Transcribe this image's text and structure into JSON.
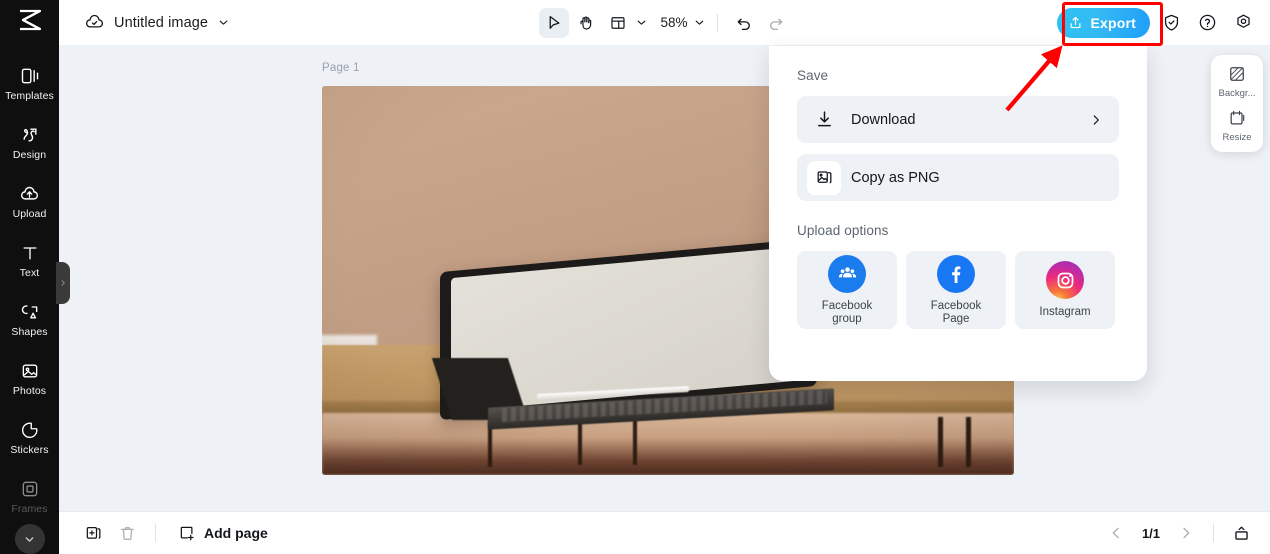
{
  "app": {
    "logo_icon": "capcut-logo-icon"
  },
  "sidebar": {
    "items": [
      {
        "label": "Templates",
        "icon": "templates-icon",
        "dim": false
      },
      {
        "label": "Design",
        "icon": "design-icon",
        "dim": false
      },
      {
        "label": "Upload",
        "icon": "upload-cloud-icon",
        "dim": false
      },
      {
        "label": "Text",
        "icon": "text-icon",
        "dim": false
      },
      {
        "label": "Shapes",
        "icon": "shapes-icon",
        "dim": false
      },
      {
        "label": "Photos",
        "icon": "photos-icon",
        "dim": false
      },
      {
        "label": "Stickers",
        "icon": "stickers-icon",
        "dim": false
      },
      {
        "label": "Frames",
        "icon": "frames-icon",
        "dim": true
      }
    ],
    "more_icon": "chevron-down-icon",
    "collapse_handle_icon": "chevron-right-icon"
  },
  "topbar": {
    "cloud_icon": "cloud-saved-icon",
    "doc_title": "Untitled image",
    "title_chevron_icon": "chevron-down-icon",
    "select_tool_icon": "cursor-arrow-icon",
    "hand_tool_icon": "hand-icon",
    "layout_tool_icon": "layout-grid-icon",
    "layout_chevron_icon": "chevron-down-icon",
    "zoom_value": "58%",
    "zoom_chevron_icon": "chevron-down-icon",
    "undo_icon": "undo-icon",
    "redo_icon": "redo-icon",
    "export_label": "Export",
    "export_icon": "upload-share-icon",
    "export_color": "#2ab5f2",
    "shield_icon": "shield-check-icon",
    "help_icon": "question-circle-icon",
    "settings_icon": "settings-gear-icon",
    "highlight_color": "#ff0000"
  },
  "canvas": {
    "page_label": "Page 1",
    "background_color": "#eef1f5"
  },
  "right_tools": {
    "items": [
      {
        "label": "Backgr...",
        "icon": "background-pattern-icon"
      },
      {
        "label": "Resize",
        "icon": "resize-icon"
      }
    ]
  },
  "export_panel": {
    "save_heading": "Save",
    "save_items": [
      {
        "label": "Download",
        "icon": "download-icon",
        "chevron": "chevron-right-icon",
        "has_white_box": false
      },
      {
        "label": "Copy as PNG",
        "icon": "copy-image-icon",
        "chevron": "",
        "has_white_box": true
      }
    ],
    "upload_heading": "Upload options",
    "upload_items": [
      {
        "label": "Facebook\ngroup",
        "icon": "facebook-group-icon",
        "badge": "fb"
      },
      {
        "label": "Facebook\nPage",
        "icon": "facebook-icon",
        "badge": "fbp"
      },
      {
        "label": "Instagram",
        "icon": "instagram-icon",
        "badge": "ig"
      }
    ]
  },
  "bottombar": {
    "duplicate_icon": "duplicate-page-icon",
    "delete_icon": "trash-icon",
    "add_page_label": "Add page",
    "add_page_icon": "add-page-icon",
    "prev_icon": "chevron-left-icon",
    "page_count": "1/1",
    "next_icon": "chevron-right-icon",
    "present_icon": "present-icon"
  }
}
